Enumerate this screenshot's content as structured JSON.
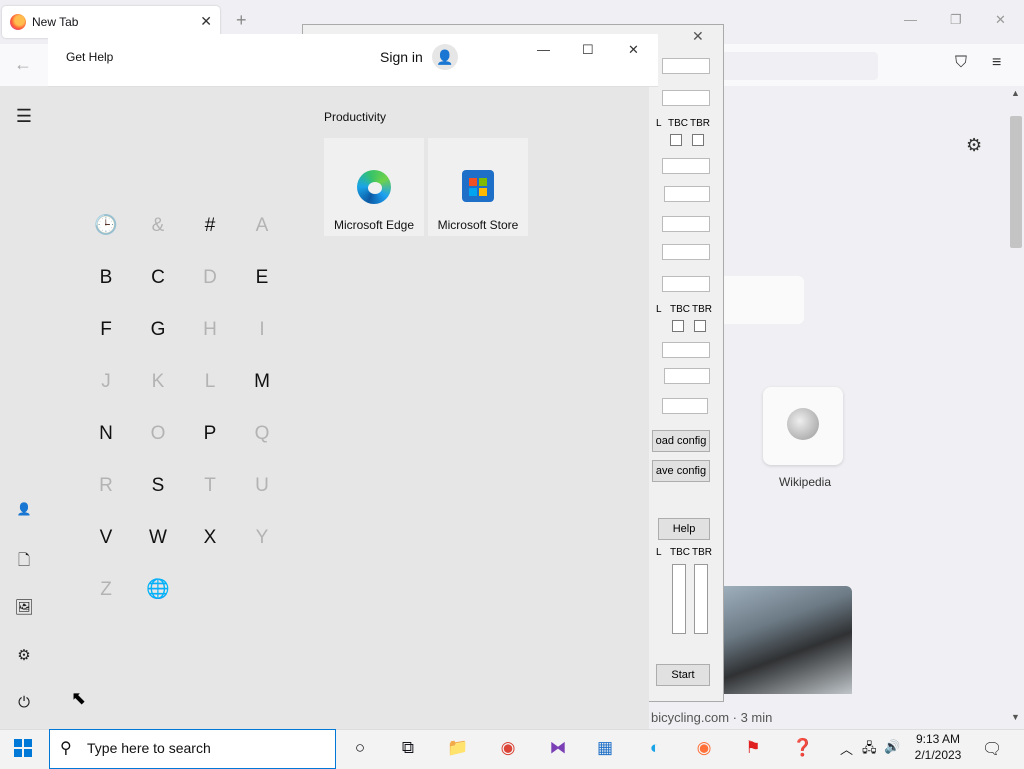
{
  "browser": {
    "tab_title": "New Tab",
    "tab_close": "✕",
    "new_tab_glyph": "+",
    "minimize_glyph": "—",
    "restore_glyph": "❐",
    "close_glyph": "✕",
    "back_glyph": "←",
    "pocket_glyph": "⛉",
    "menu_glyph": "≡",
    "settings_glyph": "⚙",
    "wiki_label": "Wikipedia",
    "story_meta": "bicycling.com · 3 min"
  },
  "config_window": {
    "close_glyph": "✕",
    "col_labels_row1": [
      "L",
      "TBC",
      "TBR"
    ],
    "col_labels_row2": [
      "L",
      "TBC",
      "TBR"
    ],
    "col_labels_row3": [
      "L",
      "TBC",
      "TBR"
    ],
    "load_config": "oad config",
    "save_config": "ave config",
    "help": "Help",
    "start": "Start"
  },
  "get_help": {
    "title": "Get Help",
    "sign_in": "Sign in",
    "minimize_glyph": "—",
    "maximize_glyph": "☐",
    "close_glyph": "✕"
  },
  "start_menu": {
    "hamburger": "☰",
    "group_title": "Productivity",
    "tiles": [
      {
        "label": "Microsoft Edge"
      },
      {
        "label": "Microsoft Store"
      }
    ],
    "letters": [
      {
        "char": "🕒",
        "dim": true
      },
      {
        "char": "&",
        "dim": true
      },
      {
        "char": "#",
        "dim": false
      },
      {
        "char": "A",
        "dim": true
      },
      {
        "char": "B",
        "dim": false
      },
      {
        "char": "C",
        "dim": false
      },
      {
        "char": "D",
        "dim": true
      },
      {
        "char": "E",
        "dim": false
      },
      {
        "char": "F",
        "dim": false
      },
      {
        "char": "G",
        "dim": false
      },
      {
        "char": "H",
        "dim": true
      },
      {
        "char": "I",
        "dim": true
      },
      {
        "char": "J",
        "dim": true
      },
      {
        "char": "K",
        "dim": true
      },
      {
        "char": "L",
        "dim": true
      },
      {
        "char": "M",
        "dim": false
      },
      {
        "char": "N",
        "dim": false
      },
      {
        "char": "O",
        "dim": true
      },
      {
        "char": "P",
        "dim": false
      },
      {
        "char": "Q",
        "dim": true
      },
      {
        "char": "R",
        "dim": true
      },
      {
        "char": "S",
        "dim": false
      },
      {
        "char": "T",
        "dim": true
      },
      {
        "char": "U",
        "dim": true
      },
      {
        "char": "V",
        "dim": false
      },
      {
        "char": "W",
        "dim": false
      },
      {
        "char": "X",
        "dim": false
      },
      {
        "char": "Y",
        "dim": true
      },
      {
        "char": "Z",
        "dim": true
      },
      {
        "char": "🌐",
        "dim": true
      }
    ],
    "rail_icons": {
      "user": "👤",
      "documents": "🗋",
      "pictures": "🖼",
      "settings": "⚙",
      "power": "⏻"
    }
  },
  "taskbar": {
    "search_placeholder": "Type here to search",
    "search_glyph": "⚲",
    "cortana_glyph": "○",
    "taskview_glyph": "⧉",
    "time": "9:13 AM",
    "date": "2/1/2023",
    "tray_chevron": "︿",
    "tray_network": "🖧",
    "tray_volume": "🔊",
    "notification_glyph": "🗨",
    "pinned": [
      {
        "name": "file-explorer-icon",
        "glyph": "📁",
        "color": "#e8b339"
      },
      {
        "name": "chrome-icon",
        "glyph": "◉",
        "color": "#db4437"
      },
      {
        "name": "visual-studio-icon",
        "glyph": "⧓",
        "color": "#7a3fb5"
      },
      {
        "name": "microsoft-store-icon",
        "glyph": "▦",
        "color": "#1e6fc7"
      },
      {
        "name": "edge-icon",
        "glyph": "◐",
        "color": "#1aa4e8"
      },
      {
        "name": "firefox-icon",
        "glyph": "◉",
        "color": "#ff7139"
      },
      {
        "name": "acrobat-icon",
        "glyph": "⚑",
        "color": "#e02020"
      },
      {
        "name": "quick-assist-icon",
        "glyph": "❓",
        "color": "#1f6fbf"
      }
    ]
  }
}
